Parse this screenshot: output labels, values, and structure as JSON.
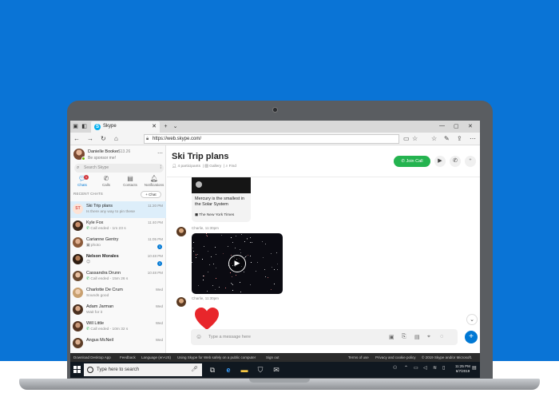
{
  "browser": {
    "tab_title": "Skype",
    "url": "https://web.skype.com/"
  },
  "me": {
    "name": "Danielle Booker",
    "amount": "$13.26",
    "mood": "Be sponsor me!"
  },
  "sidebar": {
    "search_placeholder": "Search Skype",
    "tabs": [
      {
        "label": "Chats",
        "icon": "chat-icon",
        "badge": "1"
      },
      {
        "label": "Calls",
        "icon": "phone-icon"
      },
      {
        "label": "Contacts",
        "icon": "contacts-icon"
      },
      {
        "label": "Notifications",
        "icon": "bell-icon"
      }
    ],
    "recent_header": "RECENT CHATS",
    "new_chat_label": "+ Chat"
  },
  "chats": [
    {
      "name": "Ski Trip plans",
      "preview": "Is there any way to pin these",
      "time": "11:20 PM",
      "initials": "ST"
    },
    {
      "name": "Kyle Fox",
      "preview": "Call ended - 1m 23 s",
      "time": "11:40 PM"
    },
    {
      "name": "Carianne Gentry",
      "preview": "photo",
      "time": "11:05 PM",
      "badge": "1"
    },
    {
      "name": "Nelson Morales",
      "preview": "",
      "time": "10:48 PM",
      "badge": "1"
    },
    {
      "name": "Cassandra Drunn",
      "preview": "Call ended - 15m 26 s",
      "time": "10:48 PM"
    },
    {
      "name": "Charlotte De Crum",
      "preview": "Sounds good",
      "time": "Wed"
    },
    {
      "name": "Adam Jarman",
      "preview": "Wait for it",
      "time": "Wed"
    },
    {
      "name": "Will Little",
      "preview": "Call ended - 10m 32 s",
      "time": "Wed"
    },
    {
      "name": "Angus McNeil",
      "preview": "",
      "time": "Wed"
    }
  ],
  "conversation": {
    "title": "Ski Trip plans",
    "participants": "4 participants",
    "gallery": "Gallery",
    "find": "Find",
    "join_call": "Join Call"
  },
  "messages": {
    "link_title": "Mercury is the smallest in the Solar System",
    "link_source": "The New York Times",
    "sender1": "Charlie, 11:30pm",
    "sender2": "Charlie, 11:30pm"
  },
  "compose": {
    "placeholder": "Type a message here"
  },
  "footer": {
    "download": "Download Desktop App",
    "feedback": "Feedback",
    "language": "Language (en-US)",
    "safety": "Using Skype for Web safely on a public computer",
    "signout": "Sign out",
    "terms": "Terms of use",
    "privacy": "Privacy and cookie policy",
    "copyright": "© 2019 Skype and/or Microsoft."
  },
  "taskbar": {
    "search_placeholder": "Type here to search",
    "time": "11:25 PM",
    "date": "6/7/2019"
  },
  "colors": {
    "background": "#0a74d6",
    "join_call": "#24b34f",
    "accent": "#0078d4"
  }
}
